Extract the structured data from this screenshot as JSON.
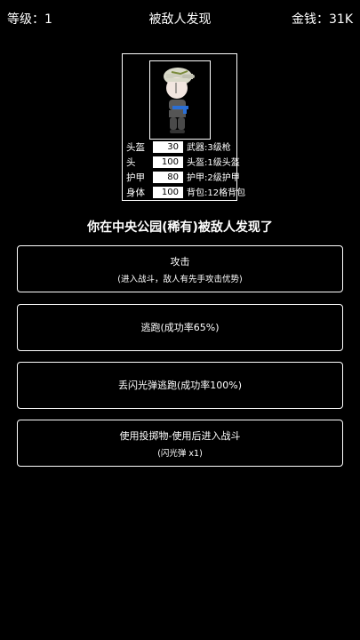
{
  "header": {
    "level": "等级：1",
    "title": "被敌人发现",
    "money": "金钱：31K"
  },
  "stats": [
    {
      "label": "头盔",
      "value": "30",
      "equip": "武器:3级枪"
    },
    {
      "label": "头",
      "value": "100",
      "equip": "头盔:1级头盔"
    },
    {
      "label": "护甲",
      "value": "80",
      "equip": "护甲:2级护甲"
    },
    {
      "label": "身体",
      "value": "100",
      "equip": "背包:12格背包"
    }
  ],
  "headline": "你在中央公园(稀有)被敌人发现了",
  "actions": {
    "attack": {
      "label": "攻击",
      "sub": "(进入战斗，敌人有先手攻击优势)"
    },
    "flee": {
      "label": "逃跑(成功率65%)"
    },
    "flash_flee": {
      "label": "丢闪光弹逃跑(成功率100%)"
    },
    "throwable": {
      "label": "使用投掷物-使用后进入战斗",
      "sub": "(闪光弹 x1)"
    }
  },
  "colors": {
    "background": "#000000",
    "text": "#ffffff"
  }
}
